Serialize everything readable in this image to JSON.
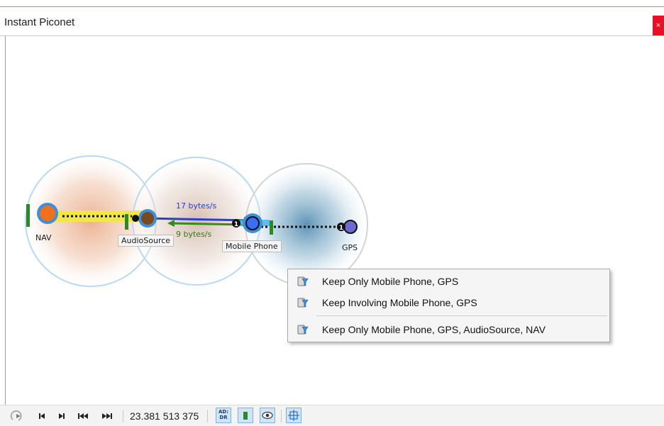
{
  "window": {
    "title": "Instant Piconet",
    "close_label": "×"
  },
  "graph": {
    "nodes": [
      {
        "id": "nav",
        "label": "NAV",
        "color": "#f07020"
      },
      {
        "id": "audiosource",
        "label": "AudioSource",
        "color": "#7a4a1e"
      },
      {
        "id": "mobile-phone",
        "label": "Mobile Phone",
        "color": "#3b6ef2"
      },
      {
        "id": "gps",
        "label": "GPS",
        "color": "#6a6ad0"
      }
    ],
    "links": [
      {
        "from": "audiosource",
        "to": "mobile-phone",
        "rate": "17 bytes/s",
        "color": "#2b3fcf"
      },
      {
        "from": "mobile-phone",
        "to": "audiosource",
        "rate": "9 bytes/s",
        "color": "#3a8a1a"
      }
    ],
    "badges": [
      "1",
      "1"
    ]
  },
  "context_menu": {
    "items": [
      {
        "label": "Keep Only Mobile Phone, GPS",
        "icon": "filter-icon"
      },
      {
        "label": "Keep Involving Mobile Phone, GPS",
        "icon": "filter-icon"
      },
      {
        "label": "Keep Only Mobile Phone, GPS, AudioSource, NAV",
        "icon": "filter-icon"
      }
    ]
  },
  "statusbar": {
    "time": "23.381 513 375",
    "ad_dr_label_top": "AD:",
    "ad_dr_label_bottom": "DR",
    "icons": [
      "play-icon",
      "skip-start-icon",
      "skip-end-icon",
      "rewind-icon",
      "fast-forward-icon",
      "ad-dr-icon",
      "battery-icon",
      "eye-icon",
      "layout-icon"
    ]
  },
  "colors": {
    "accent": "#3c8fd8",
    "close": "#e81123",
    "nav_link": "#f2e64a"
  }
}
